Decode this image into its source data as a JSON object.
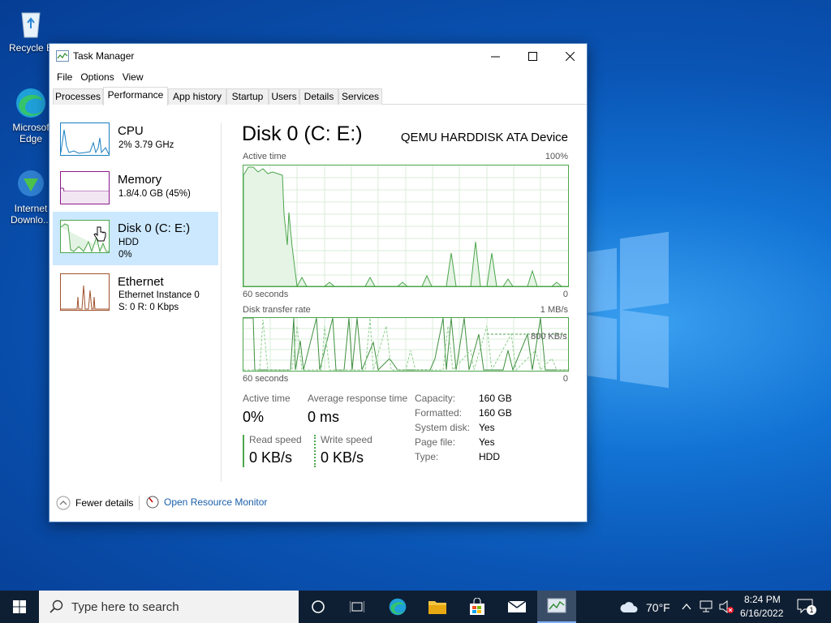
{
  "desktop": {
    "icons": [
      {
        "label": "Recycle Bin",
        "icon": "recycle-bin-icon"
      },
      {
        "label": "Microsoft Edge",
        "icon": "edge-icon"
      },
      {
        "label": "Internet Downlo...",
        "icon": "idm-icon"
      }
    ],
    "icon_labels_visible": [
      "Recycle B",
      "Microsof\nEdge",
      "Internet\nDownlo..."
    ]
  },
  "window": {
    "title": "Task Manager",
    "menu": [
      "File",
      "Options",
      "View"
    ],
    "tabs": [
      "Processes",
      "Performance",
      "App history",
      "Startup",
      "Users",
      "Details",
      "Services"
    ],
    "active_tab": "Performance"
  },
  "sidebar": {
    "items": [
      {
        "name": "CPU",
        "line1": "2% 3.79 GHz",
        "line2": "",
        "color": "#1a7fc1"
      },
      {
        "name": "Memory",
        "line1": "1.8/4.0 GB (45%)",
        "line2": "",
        "color": "#8b1a8b"
      },
      {
        "name": "Disk 0 (C: E:)",
        "line1": "HDD",
        "line2": "0%",
        "color": "#4ca64c"
      },
      {
        "name": "Ethernet",
        "line1": "Ethernet Instance 0",
        "line2": "S: 0 R: 0 Kbps",
        "color": "#a0522d"
      }
    ],
    "selected": "Disk 0 (C: E:)"
  },
  "detail": {
    "title": "Disk 0 (C: E:)",
    "device": "QEMU HARDDISK ATA Device",
    "graph1": {
      "label": "Active time",
      "max": "100%",
      "left": "60 seconds",
      "right": "0"
    },
    "graph2": {
      "label": "Disk transfer rate",
      "max": "1 MB/s",
      "mark": "800 KB/s",
      "left": "60 seconds",
      "right": "0"
    },
    "stats": {
      "active_time_label": "Active time",
      "active_time": "0%",
      "avg_resp_label": "Average response time",
      "avg_resp": "0 ms",
      "read_label": "Read speed",
      "read": "0 KB/s",
      "write_label": "Write speed",
      "write": "0 KB/s"
    },
    "props": [
      {
        "label": "Capacity:",
        "value": "160 GB"
      },
      {
        "label": "Formatted:",
        "value": "160 GB"
      },
      {
        "label": "System disk:",
        "value": "Yes"
      },
      {
        "label": "Page file:",
        "value": "Yes"
      },
      {
        "label": "Type:",
        "value": "HDD"
      }
    ]
  },
  "footer": {
    "fewer": "Fewer details",
    "resmon": "Open Resource Monitor"
  },
  "taskbar": {
    "search_placeholder": "Type here to search",
    "weather": "70°F",
    "time": "8:24 PM",
    "date": "6/16/2022",
    "notifications": "1"
  },
  "colors": {
    "disk": "#4ca64c",
    "link": "#1a5fa8",
    "taskbar": "#0f1f33",
    "selected": "#cce8ff"
  }
}
